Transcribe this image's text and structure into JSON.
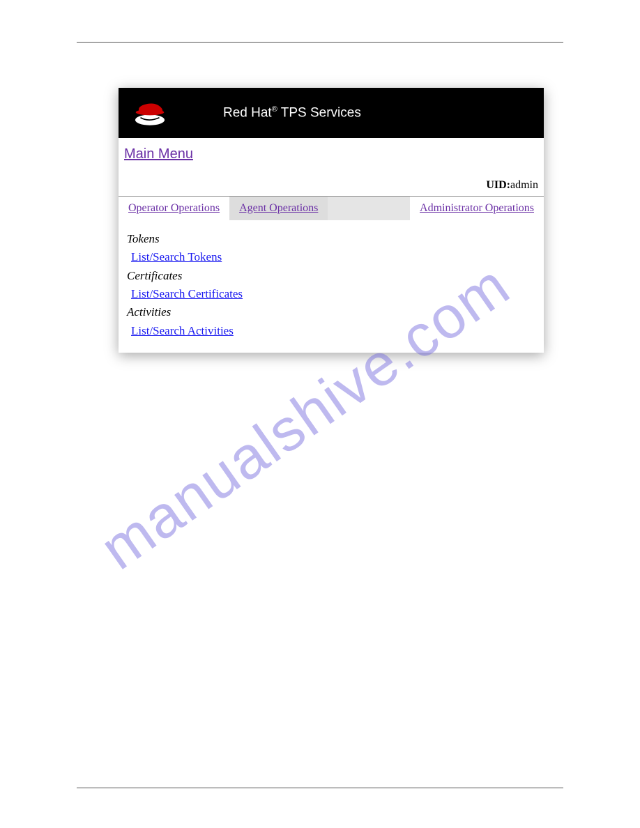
{
  "app": {
    "title_prefix": "Red Hat",
    "title_suffix": " TPS Services"
  },
  "main_menu": "Main Menu",
  "uid": {
    "label": "UID:",
    "value": "admin"
  },
  "tabs": [
    {
      "label": "Operator Operations"
    },
    {
      "label": "Agent Operations"
    },
    {
      "label": "Administrator Operations"
    }
  ],
  "sections": {
    "tokens_heading": "Tokens",
    "tokens_link": "List/Search Tokens",
    "certs_heading": "Certificates",
    "certs_link": "List/Search Certificates",
    "acts_heading": "Activities",
    "acts_link": "List/Search Activities"
  },
  "watermark": "manualshive.com"
}
